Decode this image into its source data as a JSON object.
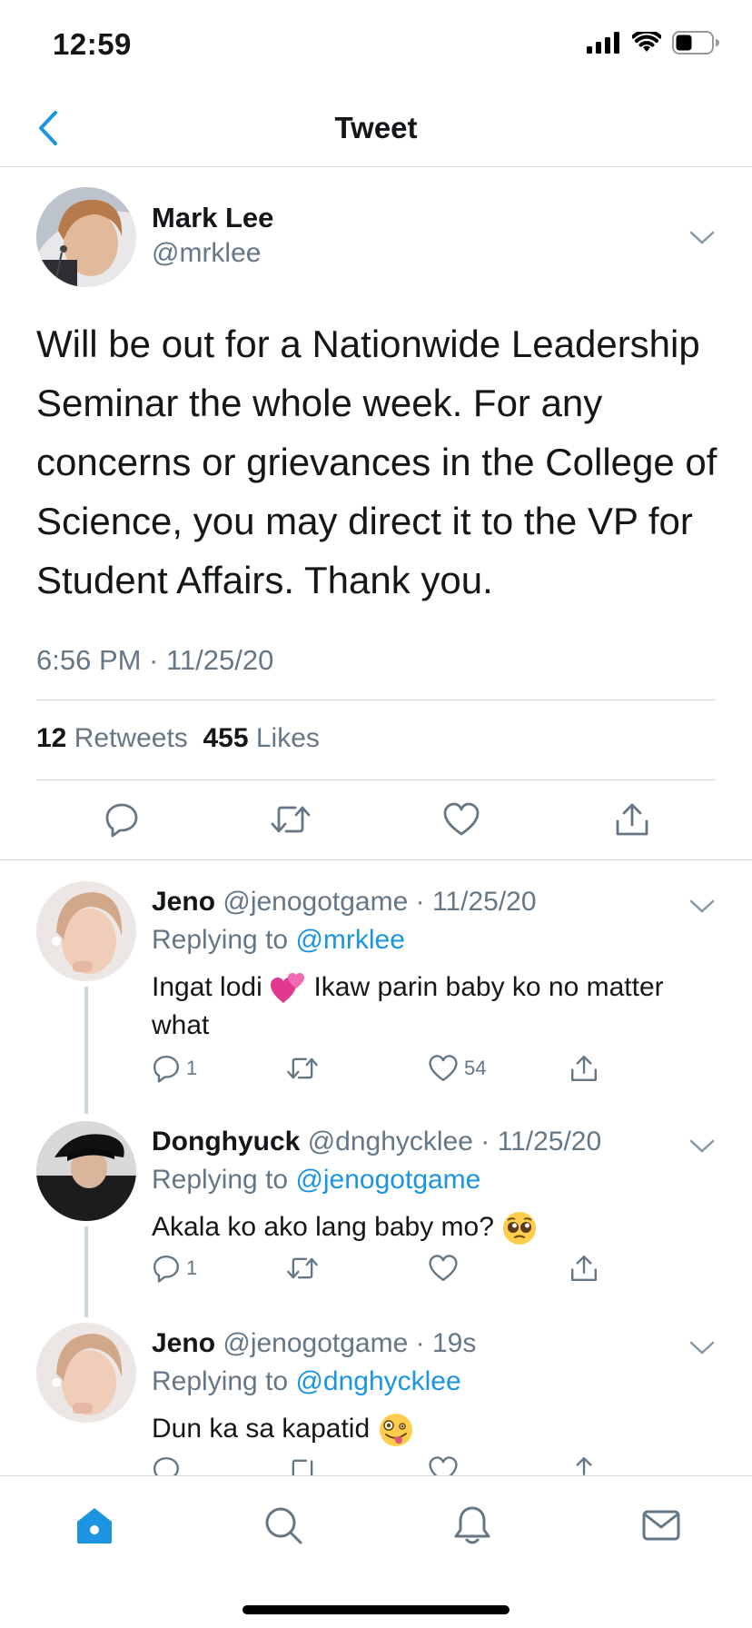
{
  "status_bar": {
    "time": "12:59",
    "icons": [
      "signal-icon",
      "wifi-icon",
      "battery-icon"
    ]
  },
  "nav": {
    "title": "Tweet",
    "back_icon": "chevron-left-icon"
  },
  "colors": {
    "accent": "#1b95e0",
    "secondary_text": "#657786",
    "divider": "#d6dbe0",
    "text": "#14171a"
  },
  "main_tweet": {
    "name": "Mark Lee",
    "handle": "@mrklee",
    "text": "Will be out for a Nationwide Leadership Seminar the whole week. For any concerns or grievances in the College of Science, you may direct it to the VP for Student Affairs. Thank you.",
    "timestamp": "6:56 PM · 11/25/20",
    "retweets_count": "12",
    "retweets_label": "Retweets",
    "likes_count": "455",
    "likes_label": "Likes"
  },
  "replies": [
    {
      "name": "Jeno",
      "handle": "@jenogotgame",
      "time": "· 11/25/20",
      "replying_prefix": "Replying to",
      "replying_to": "@mrklee",
      "text_before_emoji": "Ingat lodi",
      "emoji": "two-hearts-emoji",
      "text_after_emoji": "Ikaw parin baby ko no matter what",
      "reply_count": "1",
      "retweet_count": "",
      "like_count": "54"
    },
    {
      "name": "Donghyuck",
      "handle": "@dnghycklee",
      "time": "· 11/25/20",
      "replying_prefix": "Replying to",
      "replying_to": "@jenogotgame",
      "text": "Akala ko ako lang baby mo?",
      "emoji": "pleading-face-emoji",
      "reply_count": "1",
      "retweet_count": "",
      "like_count": ""
    },
    {
      "name": "Jeno",
      "handle": "@jenogotgame",
      "time": "· 19s",
      "replying_prefix": "Replying to",
      "replying_to": "@dnghycklee",
      "text": "Dun ka sa kapatid",
      "emoji": "zany-face-emoji"
    }
  ],
  "tab_bar": {
    "tabs": [
      "home-icon",
      "search-icon",
      "bell-icon",
      "mail-icon"
    ],
    "active": "home-icon"
  }
}
